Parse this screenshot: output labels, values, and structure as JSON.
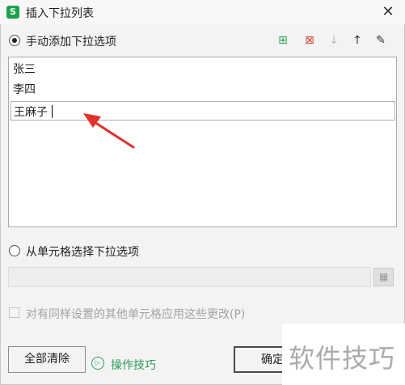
{
  "dialog": {
    "title": "插入下拉列表",
    "app_icon": "S",
    "close_glyph": "✕"
  },
  "manual": {
    "label": "手动添加下拉选项",
    "selected": true,
    "toolbar": [
      {
        "name": "add-item-icon",
        "glyph": "⊞",
        "color": "#2e9d4f"
      },
      {
        "name": "delete-item-icon",
        "glyph": "⊠",
        "color": "#d9463b"
      },
      {
        "name": "move-down-icon",
        "glyph": "↓",
        "color": "#bbbbbb"
      },
      {
        "name": "move-up-icon",
        "glyph": "↑",
        "color": "#333333"
      },
      {
        "name": "edit-item-icon",
        "glyph": "✎",
        "color": "#333333"
      }
    ],
    "items": [
      "张三",
      "李四",
      "王麻子"
    ]
  },
  "cell_source": {
    "label": "从单元格选择下拉选项",
    "selected": false,
    "range_value": "",
    "range_button_glyph": "▦"
  },
  "apply_all": {
    "label": "对有同样设置的其他单元格应用这些更改(P)",
    "checked": false
  },
  "footer": {
    "clear_label": "全部清除",
    "help_label": "操作技巧",
    "help_glyph": "▷",
    "ok_label": "确定"
  },
  "watermark": "软件技巧",
  "annotation": {
    "color": "#e0312a"
  }
}
